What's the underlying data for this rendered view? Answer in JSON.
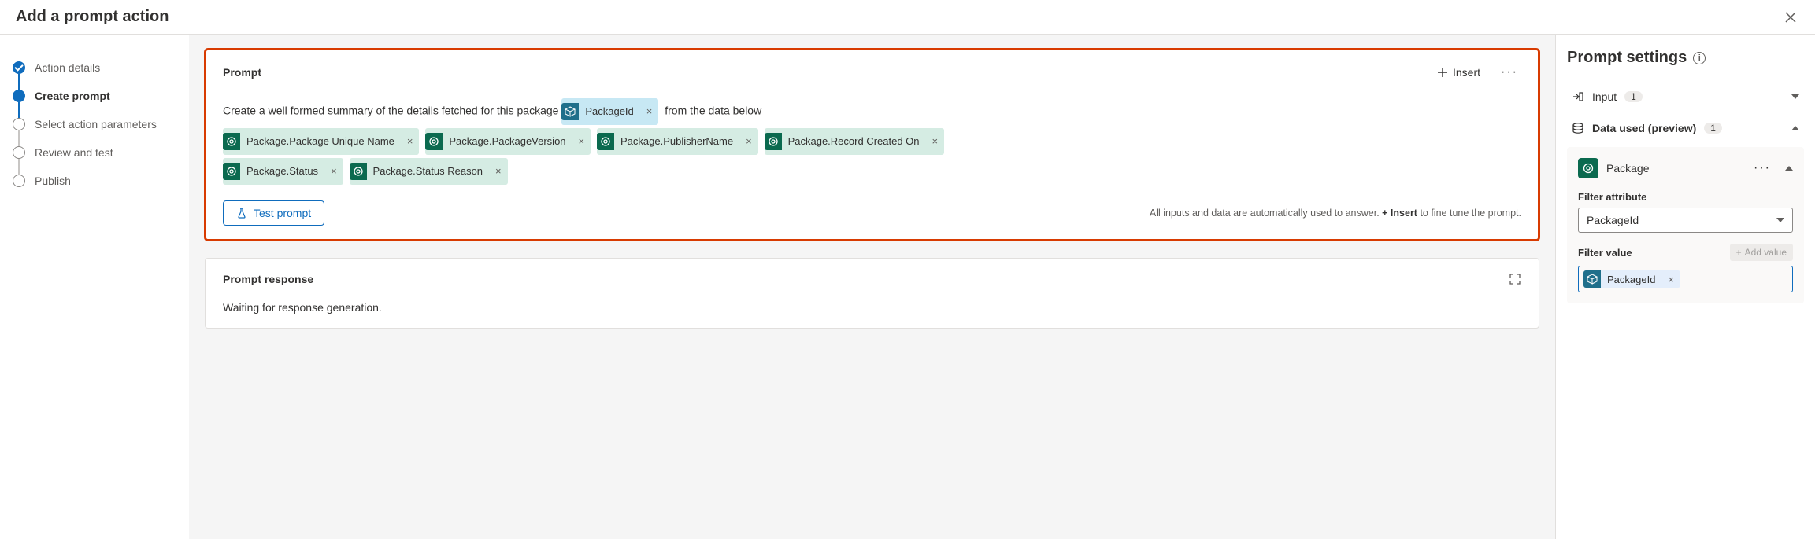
{
  "header": {
    "title": "Add a prompt action"
  },
  "nav": {
    "items": [
      {
        "label": "Action details",
        "state": "done"
      },
      {
        "label": "Create prompt",
        "state": "active"
      },
      {
        "label": "Select action parameters",
        "state": "pending"
      },
      {
        "label": "Review and test",
        "state": "pending"
      },
      {
        "label": "Publish",
        "state": "pending"
      }
    ]
  },
  "prompt_card": {
    "title": "Prompt",
    "insert_label": "Insert",
    "text_before": "Create a well formed summary of the details fetched for this package",
    "inline_token": "PackageId",
    "text_after": "from the data below",
    "tokens": [
      "Package.Package Unique Name",
      "Package.PackageVersion",
      "Package.PublisherName",
      "Package.Record Created On",
      "Package.Status",
      "Package.Status Reason"
    ],
    "test_label": "Test prompt",
    "hint_before": "All inputs and data are automatically used to answer. ",
    "hint_bold": "+ Insert",
    "hint_after": " to fine tune the prompt."
  },
  "response_card": {
    "title": "Prompt response",
    "body": "Waiting for response generation."
  },
  "panel": {
    "title": "Prompt settings",
    "input_section": {
      "label": "Input",
      "count": "1"
    },
    "data_section": {
      "label": "Data used (preview)",
      "count": "1"
    },
    "package": {
      "name": "Package",
      "filter_attribute_label": "Filter attribute",
      "filter_attribute_value": "PackageId",
      "filter_value_label": "Filter value",
      "add_value_label": "Add value",
      "filter_value_chip": "PackageId"
    }
  }
}
